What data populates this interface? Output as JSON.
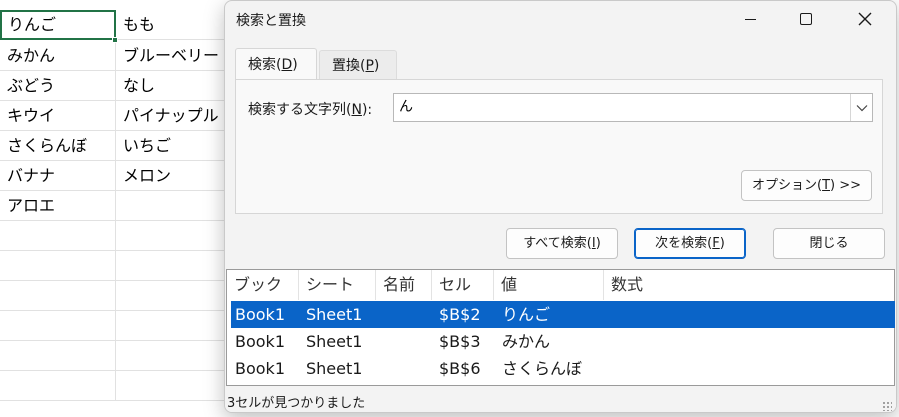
{
  "sheet": {
    "rows": [
      {
        "a": "りんご",
        "b": "もも"
      },
      {
        "a": "みかん",
        "b": "ブルーベリー"
      },
      {
        "a": "ぶどう",
        "b": "なし"
      },
      {
        "a": "キウイ",
        "b": "パイナップル"
      },
      {
        "a": "さくらんぼ",
        "b": "いちご"
      },
      {
        "a": "バナナ",
        "b": "メロン"
      },
      {
        "a": "アロエ",
        "b": ""
      }
    ]
  },
  "dialog": {
    "title": "検索と置換",
    "tabs": {
      "find": {
        "label": "検索(",
        "key": "D",
        "suffix": ")"
      },
      "replace": {
        "label": "置換(",
        "key": "P",
        "suffix": ")"
      }
    },
    "find_label": {
      "text": "検索する文字列(",
      "key": "N",
      "suffix": "):"
    },
    "find_value": "ん",
    "options_button": {
      "text": "オプション(",
      "key": "T",
      "suffix": ") >>"
    },
    "buttons": {
      "find_all": {
        "text": "すべて検索(",
        "key": "I",
        "suffix": ")"
      },
      "find_next": {
        "text": "次を検索(",
        "key": "F",
        "suffix": ")"
      },
      "close": "閉じる"
    },
    "results": {
      "columns": [
        "ブック",
        "シート",
        "名前",
        "セル",
        "値",
        "数式"
      ],
      "rows": [
        {
          "book": "Book1",
          "sheet": "Sheet1",
          "name": "",
          "cell": "$B$2",
          "value": "りんご",
          "formula": ""
        },
        {
          "book": "Book1",
          "sheet": "Sheet1",
          "name": "",
          "cell": "$B$3",
          "value": "みかん",
          "formula": ""
        },
        {
          "book": "Book1",
          "sheet": "Sheet1",
          "name": "",
          "cell": "$B$6",
          "value": "さくらんぼ",
          "formula": ""
        }
      ]
    },
    "status": "3セルが見つかりました"
  },
  "colors": {
    "accent": "#0a64c8",
    "active_cell": "#217346"
  },
  "icons": [
    "minimize-icon",
    "maximize-icon",
    "close-icon",
    "chevron-down-icon",
    "resize-grip-icon"
  ]
}
